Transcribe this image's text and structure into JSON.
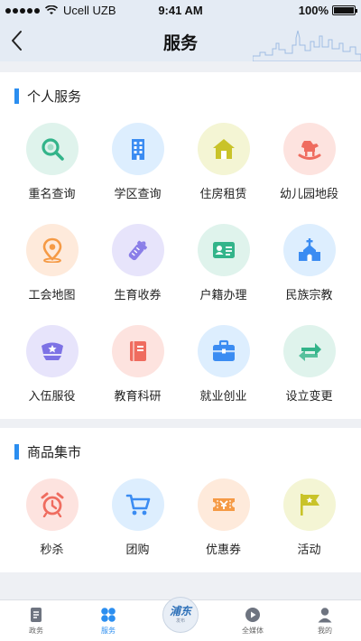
{
  "status_bar": {
    "carrier": "Ucell UZB",
    "time": "9:41 AM",
    "battery": "100%"
  },
  "nav": {
    "title": "服务",
    "back_icon": "chevron-left-icon"
  },
  "personal": {
    "title": "个人服务",
    "items": [
      {
        "label": "重名查询",
        "icon": "search-icon",
        "bg": "#dff3ec",
        "fg": "#33b48a"
      },
      {
        "label": "学区查询",
        "icon": "building-icon",
        "bg": "#ddeefe",
        "fg": "#3b8cf2"
      },
      {
        "label": "住房租赁",
        "icon": "house-icon",
        "bg": "#f4f5d4",
        "fg": "#c9c329"
      },
      {
        "label": "幼儿园地段",
        "icon": "rocking-horse-icon",
        "bg": "#fde3df",
        "fg": "#ef6c5f"
      },
      {
        "label": "工会地图",
        "icon": "map-pin-icon",
        "bg": "#feeadb",
        "fg": "#f59a45"
      },
      {
        "label": "生育收券",
        "icon": "baby-bottle-icon",
        "bg": "#e7e4fb",
        "fg": "#8a7ee8"
      },
      {
        "label": "户籍办理",
        "icon": "id-card-icon",
        "bg": "#dff3ec",
        "fg": "#33b48a"
      },
      {
        "label": "民族宗教",
        "icon": "church-icon",
        "bg": "#ddeefe",
        "fg": "#3b8cf2"
      },
      {
        "label": "入伍服役",
        "icon": "military-cap-icon",
        "bg": "#e7e4fb",
        "fg": "#7d72e5"
      },
      {
        "label": "教育科研",
        "icon": "book-icon",
        "bg": "#fde3df",
        "fg": "#ef6c5f"
      },
      {
        "label": "就业创业",
        "icon": "briefcase-icon",
        "bg": "#ddeefe",
        "fg": "#3b8cf2"
      },
      {
        "label": "设立变更",
        "icon": "swap-arrows-icon",
        "bg": "#dff3ec",
        "fg": "#33b48a"
      }
    ]
  },
  "market": {
    "title": "商品集市",
    "items": [
      {
        "label": "秒杀",
        "icon": "alarm-clock-icon",
        "bg": "#fde3df",
        "fg": "#ef6c5f"
      },
      {
        "label": "团购",
        "icon": "shopping-cart-icon",
        "bg": "#ddeefe",
        "fg": "#3b8cf2"
      },
      {
        "label": "优惠券",
        "icon": "coupon-icon",
        "bg": "#feeadb",
        "fg": "#f59a45"
      },
      {
        "label": "活动",
        "icon": "flag-icon",
        "bg": "#f4f5d4",
        "fg": "#c9c329"
      }
    ]
  },
  "tab_bar": {
    "tabs": [
      {
        "label": "政务",
        "icon": "document-icon",
        "active": false
      },
      {
        "label": "服务",
        "icon": "grid-icon",
        "active": true
      },
      {
        "label": "浦东",
        "icon": "pudong-logo",
        "active": false
      },
      {
        "label": "全媒体",
        "icon": "play-icon",
        "active": false
      },
      {
        "label": "我的",
        "icon": "user-icon",
        "active": false
      }
    ],
    "logo_text": "浦东",
    "logo_sub": "发布"
  }
}
